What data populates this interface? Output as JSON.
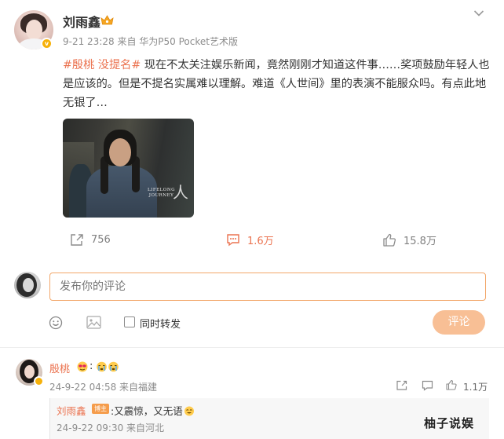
{
  "post": {
    "author": "刘雨鑫",
    "meta": "9-21 23:28  来自 华为P50 Pocket艺术版",
    "tags": [
      "#殷桃 没提名#"
    ],
    "body": "现在不太关注娱乐新闻，竟然刚刚才知道这件事……奖项鼓励年轻人也是应该的。但是不提名实属难以理解。难道《人世间》里的表演不能服众吗。有点此地无银了…",
    "image_caption_line1": "LIFELONG",
    "image_caption_line2": "JOURNEY",
    "image_caption_char": "人"
  },
  "actions": {
    "share_count": "756",
    "comment_count": "1.6万",
    "like_count": "15.8万"
  },
  "composer": {
    "placeholder": "发布你的评论",
    "repost_label": "同时转发",
    "submit_label": "评论"
  },
  "comments": [
    {
      "author": "殷桃",
      "text": ":",
      "meta": "24-9-22 04:58  来自福建",
      "like_count": "1.1万",
      "reply": {
        "author": "刘雨鑫",
        "badge": "博主",
        "text": ":又震惊，又无语",
        "meta": "24-9-22 09:30  来自河北"
      }
    }
  ],
  "watermark": "柚子说娱",
  "colors": {
    "accent": "#eb7350",
    "verify": "#f6b10a",
    "submit_disabled": "#f8bf95",
    "input_border": "#f2a76a"
  },
  "icons": {
    "header": [
      "crown-icon",
      "chevron-down-icon"
    ],
    "actions": [
      "share-icon",
      "comment-icon",
      "like-icon"
    ],
    "composer": [
      "emoji-icon",
      "image-icon"
    ]
  }
}
